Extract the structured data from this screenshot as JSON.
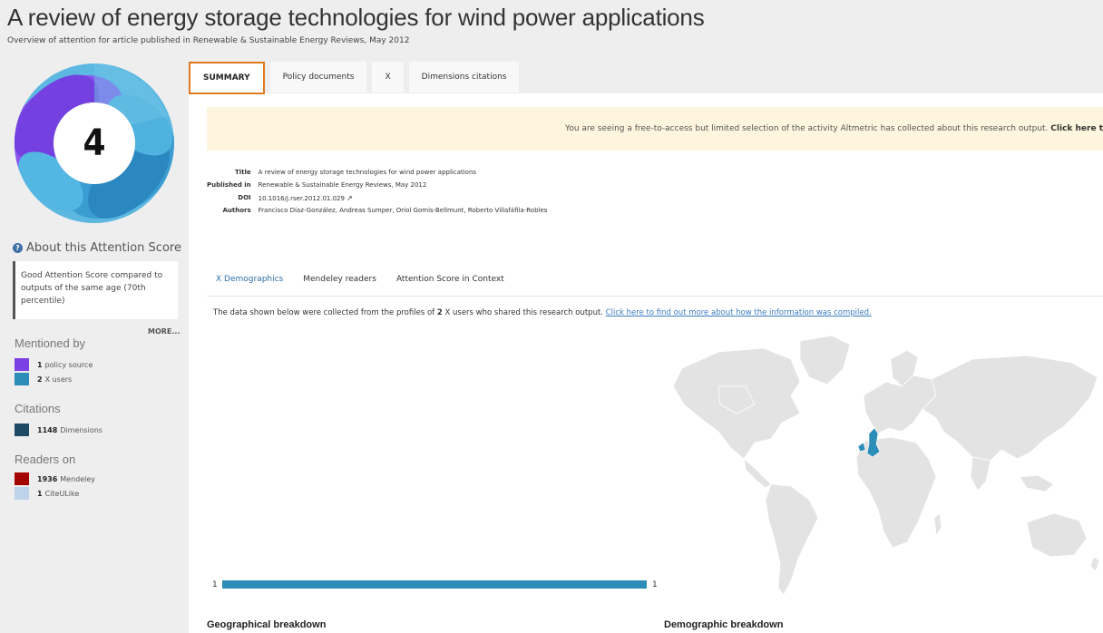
{
  "header": {
    "title": "A review of energy storage technologies for wind power applications",
    "subtitle": "Overview of attention for article published in Renewable & Sustainable Energy Reviews, May 2012"
  },
  "attention": {
    "score": "4",
    "about_label": "About this Attention Score",
    "summary": "Good Attention Score compared to outputs of the same age (70th percentile)",
    "more_label": "MORE..."
  },
  "mentioned_by": {
    "heading": "Mentioned by",
    "items": [
      {
        "count": "1",
        "label": "policy source",
        "color": "#7b3fe4"
      },
      {
        "count": "2",
        "label": "X users",
        "color": "#2b8db8"
      }
    ]
  },
  "citations": {
    "heading": "Citations",
    "items": [
      {
        "count": "1148",
        "label": "Dimensions",
        "color": "#1f4a66"
      }
    ]
  },
  "readers": {
    "heading": "Readers on",
    "items": [
      {
        "count": "1936",
        "label": "Mendeley",
        "color": "#a40000"
      },
      {
        "count": "1",
        "label": "CiteULike",
        "color": "#bcd3ea"
      }
    ]
  },
  "tabs": [
    {
      "label": "SUMMARY",
      "active": true
    },
    {
      "label": "Policy documents",
      "active": false
    },
    {
      "label": "X",
      "active": false
    },
    {
      "label": "Dimensions citations",
      "active": false
    }
  ],
  "notice": {
    "text": "You are seeing a free-to-access but limited selection of the activity Altmetric has collected about this research output. ",
    "link": "Click here t"
  },
  "metadata": {
    "title_key": "Title",
    "title_val": "A review of energy storage technologies for wind power applications",
    "published_key": "Published in",
    "published_val": "Renewable & Sustainable Energy Reviews, May 2012",
    "doi_key": "DOI",
    "doi_val": "10.1016/j.rser.2012.01.029",
    "authors_key": "Authors",
    "authors_val": "Francisco Díaz-González, Andreas Sumper, Oriol Gomis-Bellmunt, Roberto Villafáfila-Robles"
  },
  "subtabs": [
    {
      "label": "X Demographics",
      "active": true
    },
    {
      "label": "Mendeley readers",
      "active": false
    },
    {
      "label": "Attention Score in Context",
      "active": false
    }
  ],
  "data_note": {
    "prefix": "The data shown below were collected from the profiles of ",
    "count": "2",
    "middle": " X users who shared this research output. ",
    "link": "Click here to find out more about how the information was compiled."
  },
  "breakdown": {
    "bar_left": "1",
    "bar_right": "1",
    "geo_heading": "Geographical breakdown",
    "demo_heading": "Demographic breakdown",
    "highlight_color": "#2b8db8"
  }
}
